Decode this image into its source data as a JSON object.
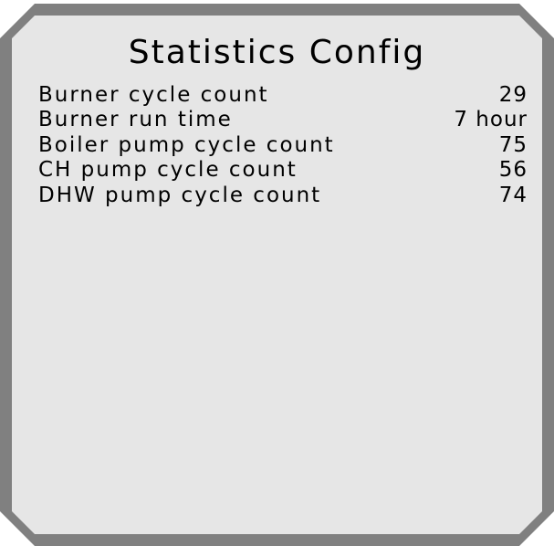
{
  "screen": {
    "title": "Statistics Config",
    "background_color": "#e6e6e6",
    "border_color": "#808080"
  },
  "stats": [
    {
      "label": "Burner cycle count",
      "value": "29"
    },
    {
      "label": "Burner run time",
      "value": "7 hour"
    },
    {
      "label": "Boiler pump cycle count",
      "value": "75"
    },
    {
      "label": "CH pump cycle count",
      "value": "56"
    },
    {
      "label": "DHW pump cycle count",
      "value": "74"
    }
  ]
}
